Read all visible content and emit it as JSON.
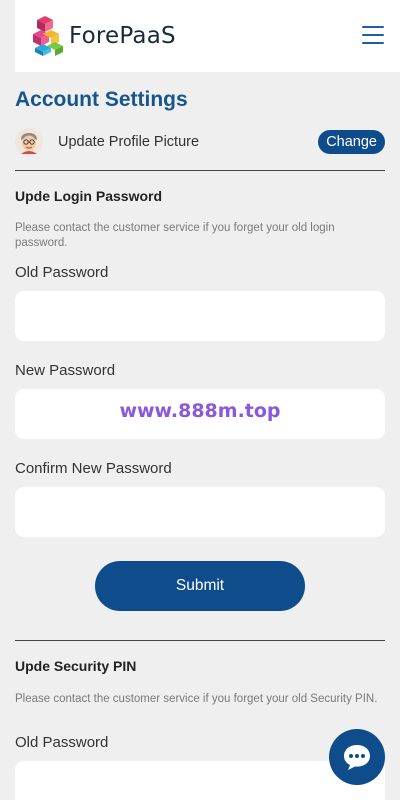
{
  "header": {
    "brand": "ForePaaS",
    "logo_icon": "cubes-logo-icon",
    "menu_icon": "hamburger-menu-icon"
  },
  "page": {
    "title": "Account Settings"
  },
  "profile": {
    "label": "Update Profile Picture",
    "change_label": "Change",
    "avatar_icon": "avatar-icon"
  },
  "login_password": {
    "title": "Upde Login Password",
    "hint": "Please contact the customer service if you forget your old login password.",
    "old_label": "Old Password",
    "old_value": "",
    "new_label": "New Password",
    "new_value": "",
    "confirm_label": "Confirm New Password",
    "confirm_value": "",
    "submit_label": "Submit"
  },
  "watermark": "www.888m.top",
  "security_pin": {
    "title": "Upde Security PIN",
    "hint": "Please contact the customer service if you forget your old Security PIN.",
    "old_label": "Old Password",
    "old_value": ""
  },
  "chat": {
    "icon": "chat-bubble-icon"
  },
  "colors": {
    "accent": "#0f4c8c",
    "title": "#17558f",
    "background": "#efefef",
    "watermark": "#8a59d9"
  }
}
